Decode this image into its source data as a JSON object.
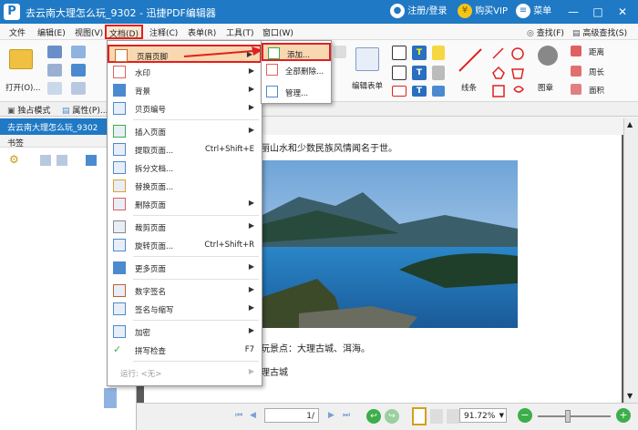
{
  "titlebar": {
    "logo": "P",
    "title": "去云南大理怎么玩_9302  -  迅捷PDF编辑器",
    "login": "注册/登录",
    "vip": "购买VIP",
    "menu": "菜单",
    "vip_symbol": "¥",
    "colors": {
      "bar": "#1f79c4",
      "vip": "#f5c518"
    }
  },
  "menubar": {
    "items": [
      "文件",
      "编辑(E)",
      "视图(V)",
      "文档(D)",
      "注释(C)",
      "表单(R)",
      "工具(T)",
      "窗口(W)"
    ],
    "right": [
      "查找(F)",
      "高级查找(S)"
    ]
  },
  "toolbar": {
    "open_label": "打开(O)...",
    "edit_form_label": "编辑表单",
    "line_label": "线条",
    "stamp_label": "图章",
    "distance_label": "距离",
    "perimeter_label": "周长",
    "area_label": "面积"
  },
  "row2": {
    "exclusive_mode": "独占模式",
    "properties": "属性(P)..."
  },
  "tab": {
    "label": "去云南大理怎么玩_9302",
    "close": "×"
  },
  "leftpanel": {
    "title": "书签"
  },
  "document_menu": {
    "items": [
      {
        "label": "页眉页脚",
        "has_sub": true,
        "highlighted": true
      },
      {
        "label": "水印",
        "has_sub": true
      },
      {
        "label": "背景",
        "has_sub": true
      },
      {
        "label": "贝页编号",
        "has_sub": true
      },
      {
        "label": "插入页面",
        "has_sub": true
      },
      {
        "label": "提取页面...",
        "shortcut": "Ctrl+Shift+E"
      },
      {
        "label": "拆分文档..."
      },
      {
        "label": "替换页面..."
      },
      {
        "label": "删除页面",
        "has_sub": true
      },
      {
        "label": "裁剪页面",
        "has_sub": true
      },
      {
        "label": "旋转页面...",
        "shortcut": "Ctrl+Shift+R"
      },
      {
        "label": "更多页面",
        "has_sub": true
      },
      {
        "label": "数字签名",
        "has_sub": true
      },
      {
        "label": "签名与缩写",
        "has_sub": true
      },
      {
        "label": "加密",
        "has_sub": true
      },
      {
        "label": "拼写检查",
        "shortcut": "F7"
      },
      {
        "label": "运行: <无>",
        "has_sub": true,
        "disabled": true
      }
    ]
  },
  "submenu": {
    "items": [
      "添加...",
      "全部删除...",
      "管理..."
    ]
  },
  "page": {
    "line1": "丽山水和少数民族风情闻名于世。",
    "line2": "玩景点：大理古城、洱海。",
    "line3": "理古城"
  },
  "statusbar": {
    "page_value": "1/",
    "zoom_value": "91.72%"
  },
  "icons": {
    "submenu_arrow": "▶",
    "dropdown_arrow": "▼",
    "scroll_up": "▲",
    "scroll_down": "▼",
    "nav_first": "⏮",
    "nav_prev": "◀",
    "nav_next": "▶",
    "nav_last": "⏭",
    "go_back": "↩",
    "go_forward": "↪",
    "zoom_out": "−",
    "zoom_in": "+",
    "gear": "⚙",
    "minimize": "—",
    "maximize": "□",
    "close": "✕"
  }
}
